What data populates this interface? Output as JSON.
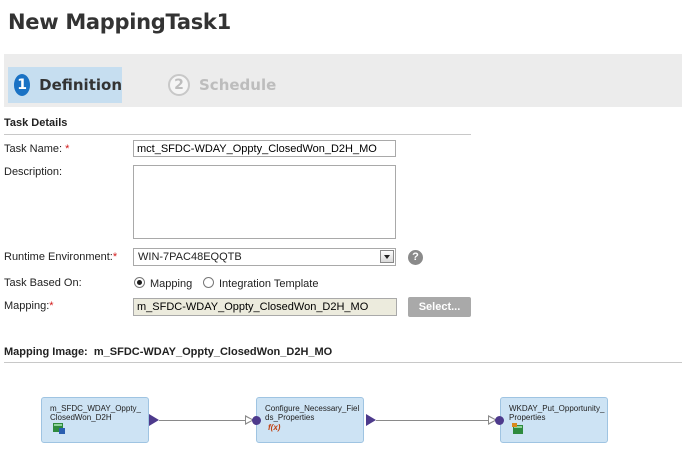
{
  "page": {
    "title": "New MappingTask1"
  },
  "wizard": {
    "steps": [
      {
        "number": "1",
        "label": "Definition",
        "state": "active"
      },
      {
        "number": "2",
        "label": "Schedule",
        "state": "inactive"
      }
    ]
  },
  "task_details": {
    "section_title": "Task Details",
    "task_name": {
      "label": "Task Name:",
      "required_mark": "*",
      "value": "mct_SFDC-WDAY_Oppty_ClosedWon_D2H_MO"
    },
    "description": {
      "label": "Description:",
      "value": ""
    },
    "runtime_environment": {
      "label": "Runtime Environment:",
      "required_mark": "*",
      "value": "WIN-7PAC48EQQTB",
      "help_icon": "question-icon"
    },
    "task_based_on": {
      "label": "Task Based On:",
      "options": [
        {
          "label": "Mapping",
          "checked": true
        },
        {
          "label": "Integration Template",
          "checked": false
        }
      ]
    },
    "mapping": {
      "label": "Mapping:",
      "required_mark": "*",
      "value": "m_SFDC-WDAY_Oppty_ClosedWon_D2H_MO",
      "select_button": "Select..."
    }
  },
  "mapping_image": {
    "title_prefix": "Mapping Image:",
    "mapping_name": "m_SFDC-WDAY_Oppty_ClosedWon_D2H_MO",
    "nodes": [
      {
        "text": "m_SFDC_WDAY_Oppty_ClosedWon_D2H",
        "icon": "source-table-icon"
      },
      {
        "text": "Configure_Necessary_Fields_Properties",
        "icon": "expression-icon",
        "icon_text": "f(x)"
      },
      {
        "text": "WKDAY_Put_Opportunity_Properties",
        "icon": "target-table-icon"
      }
    ]
  },
  "colors": {
    "accent": "#1a72c4",
    "active_step_bg": "#c6def0",
    "node_bg": "#cde3f4",
    "port": "#4d3a8c",
    "required": "#d21a1a"
  }
}
